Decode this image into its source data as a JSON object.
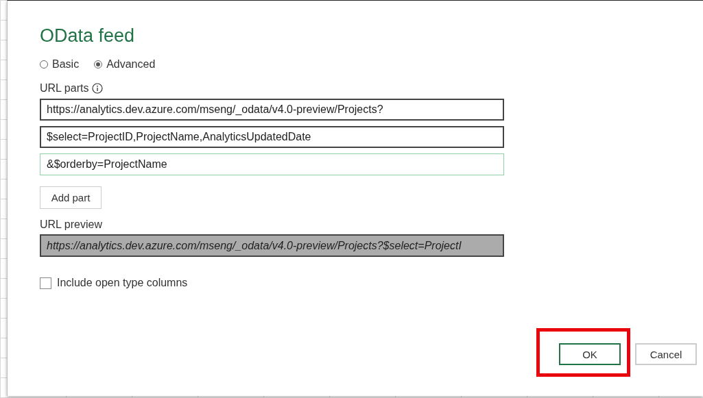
{
  "dialog": {
    "title": "OData feed",
    "modes": [
      {
        "label": "Basic",
        "selected": false
      },
      {
        "label": "Advanced",
        "selected": true
      }
    ],
    "url_parts": {
      "label": "URL parts",
      "parts": [
        {
          "value": "https://analytics.dev.azure.com/mseng/_odata/v4.0-preview/Projects?",
          "focused": false
        },
        {
          "value": "$select=ProjectID,ProjectName,AnalyticsUpdatedDate",
          "focused": false
        },
        {
          "value": "&$orderby=ProjectName",
          "focused": true
        }
      ],
      "add_button": "Add part"
    },
    "url_preview": {
      "label": "URL preview",
      "value": "https://analytics.dev.azure.com/mseng/_odata/v4.0-preview/Projects?$select=ProjectI"
    },
    "include_open_type": {
      "label": "Include open type columns",
      "checked": false
    },
    "buttons": [
      {
        "label": "OK",
        "kind": "primary",
        "highlighted": true
      },
      {
        "label": "Cancel",
        "kind": "secondary",
        "highlighted": false
      }
    ]
  }
}
